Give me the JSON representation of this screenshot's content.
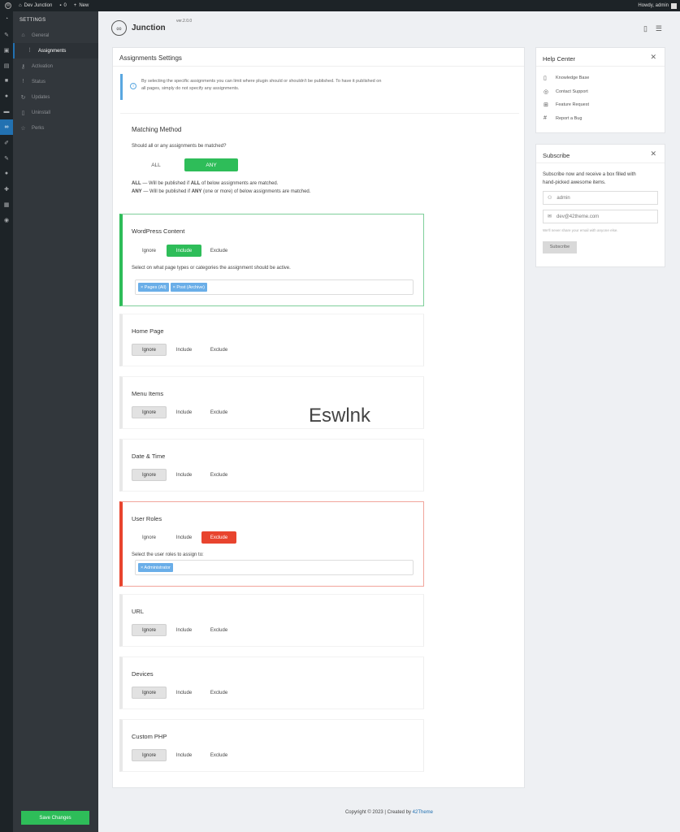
{
  "adminbar": {
    "site_name": "Dev Junction",
    "comments": "0",
    "new_label": "New",
    "howdy": "Howdy, admin"
  },
  "sidebar": {
    "heading": "SETTINGS",
    "items": [
      {
        "label": "General",
        "icon": "home-icon"
      },
      {
        "label": "Assignments",
        "icon": "sliders-icon"
      },
      {
        "label": "Activation",
        "icon": "key-icon"
      },
      {
        "label": "Status",
        "icon": "thermometer-icon"
      },
      {
        "label": "Updates",
        "icon": "refresh-icon"
      },
      {
        "label": "Uninstall",
        "icon": "trash-icon"
      },
      {
        "label": "Perks",
        "icon": "star-icon"
      }
    ],
    "save_label": "Save Changes"
  },
  "header": {
    "logo_text": "Junction",
    "version": "ver.2.0.0"
  },
  "main": {
    "title": "Assignments Settings",
    "info_line1": "By selecting the specific assignments you can limit where plugin should or shouldn't be published. To have it published on",
    "info_line2": "all pages, simply do not specify any assignments.",
    "matching": {
      "title": "Matching Method",
      "question": "Should all or any assignments be matched?",
      "all": "ALL",
      "any": "ANY",
      "desc_all_key": "ALL",
      "desc_all_a": " — Will be published if ",
      "desc_all_b": "ALL",
      "desc_all_c": " of below assignments are matched.",
      "desc_any_key": "ANY",
      "desc_any_a": " — Will be published if ",
      "desc_any_b": "ANY",
      "desc_any_c": " (one or more) of below assignments are matched."
    },
    "options": {
      "ignore": "Ignore",
      "include": "Include",
      "exclude": "Exclude"
    },
    "sections": [
      {
        "title": "WordPress Content",
        "selected": "Include",
        "hint": "Select on what page types or categories the assignment should be active.",
        "tags": [
          "× Pages (All)",
          "× Post (Archive)"
        ]
      },
      {
        "title": "Home Page",
        "selected": "Ignore"
      },
      {
        "title": "Menu Items",
        "selected": "Ignore"
      },
      {
        "title": "Date & Time",
        "selected": "Ignore"
      },
      {
        "title": "User Roles",
        "selected": "Exclude",
        "hint": "Select the user roles to assign to:",
        "tags": [
          "× Administrator"
        ]
      },
      {
        "title": "URL",
        "selected": "Ignore"
      },
      {
        "title": "Devices",
        "selected": "Ignore"
      },
      {
        "title": "Custom PHP",
        "selected": "Ignore"
      }
    ]
  },
  "watermark": "Eswlnk",
  "help": {
    "title": "Help Center",
    "items": [
      {
        "label": "Knowledge Base",
        "icon": "document-icon"
      },
      {
        "label": "Contact Support",
        "icon": "lifebuoy-icon"
      },
      {
        "label": "Feature Request",
        "icon": "plus-square-icon"
      },
      {
        "label": "Report a Bug",
        "icon": "hash-icon"
      }
    ]
  },
  "subscribe": {
    "title": "Subscribe",
    "text_line1": "Subscribe now and receive a box filled with",
    "text_line2": "hand-picked awesome items.",
    "name_value": "admin",
    "email_value": "dev@42theme.com",
    "note": "We'll never share your email with anyone else.",
    "button": "Subscribe"
  },
  "footer": {
    "text": "Copyright © 2023 | Created by ",
    "link": "42Theme"
  },
  "colors": {
    "accent_green": "#2ebd59",
    "accent_red": "#e8442e",
    "wp_blue": "#2271b1",
    "tag_blue": "#6aaee8"
  }
}
